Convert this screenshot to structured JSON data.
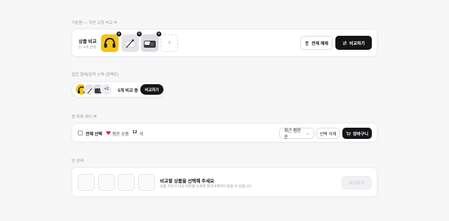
{
  "sections": {
    "s1": "기본형 — 하단 고정 비교 바",
    "s2": "접힌 형태(알약 스택 (컴팩트)",
    "s3": "찜 목록 헤더 바",
    "s4": "빈 상태"
  },
  "compare_bar": {
    "title": "상품 비교",
    "subtitle": "3 / 4개 선택",
    "clear_all": "전체 해제",
    "compare": "비교하기",
    "remove_symbol": "×",
    "add_symbol": "+"
  },
  "compact": {
    "more_count": "+2",
    "summary": "5개 비교 중",
    "compare": "비교하기"
  },
  "wishlist": {
    "select_all": "전체 선택",
    "count_prefix": "찜한 상품",
    "count": "12",
    "count_suffix": "개",
    "sort_selected": "최근 찜한 순",
    "delete_selected": "선택 삭제",
    "cart": "장바구니"
  },
  "empty": {
    "title": "비교할 상품을 선택해 주세요",
    "desc": "상품 카드의 비교 버튼을 누르면 최대 4개까지 담을 수 있습니다.",
    "compare": "비교하기"
  },
  "colors": {
    "accent_dark": "#151518",
    "heart": "#e0245e",
    "product_yellow": "#f4c21a",
    "product_gray": "#e4e4e8"
  },
  "icons": [
    "close-icon",
    "plus-icon",
    "trash-icon",
    "compare-arrows-icon",
    "heart-icon",
    "chevron-down-icon",
    "cart-icon"
  ]
}
